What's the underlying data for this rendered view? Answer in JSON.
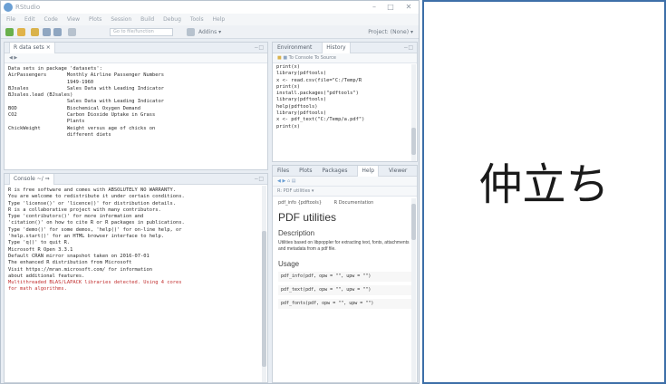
{
  "window": {
    "title": "RStudio",
    "controls": [
      "–",
      "□",
      "✕"
    ]
  },
  "menu": [
    "File",
    "Edit",
    "Code",
    "View",
    "Plots",
    "Session",
    "Build",
    "Debug",
    "Tools",
    "Help"
  ],
  "toolbar": {
    "search_placeholder": "Go to file/function",
    "addins": "Addins ▾",
    "project": "Project: (None) ▾"
  },
  "source_pane": {
    "tab": "R data sets ×",
    "header": "Data sets in package 'datasets':",
    "lines": [
      "",
      "AirPassengers       Monthly Airline Passenger Numbers",
      "                    1949-1960",
      "BJsales             Sales Data with Leading Indicator",
      "BJsales.lead (BJsales)",
      "                    Sales Data with Leading Indicator",
      "BOD                 Biochemical Oxygen Demand",
      "CO2                 Carbon Dioxide Uptake in Grass",
      "                    Plants",
      "ChickWeight         Weight versus age of chicks on",
      "                    different diets"
    ]
  },
  "console_pane": {
    "tab": "Console ~/ ⇒",
    "lines": [
      "R is free software and comes with ABSOLUTELY NO WARRANTY.",
      "You are welcome to redistribute it under certain conditions.",
      "",
      "Type 'license()' or 'licence()' for distribution details.",
      "",
      "R is a collaborative project with many contributors.",
      "Type 'contributors()' for more information and",
      "'citation()' on how to cite R or R packages in publications.",
      "",
      "Type 'demo()' for some demos, 'help()' for on-line help, or",
      "'help.start()' for an HTML browser interface to help.",
      "Type 'q()' to quit R.",
      "",
      "Microsoft R Open 3.3.1",
      "Default CRAN mirror snapshot taken on 2016-07-01",
      "The enhanced R distribution from Microsoft",
      "Visit https://mran.microsoft.com/ for information",
      "about additional features.",
      ""
    ],
    "warning_lines": [
      "Multithreaded BLAS/LAPACK libraries detected. Using 4 cores",
      "for math algorithms."
    ]
  },
  "history_pane": {
    "tabs": [
      "Environment",
      "History"
    ],
    "toolbar": "To Console   To Source",
    "lines": [
      "print(x)",
      "library(pdftools)",
      "x <- read.csv(file=\"C:/Temp/R",
      "print(x)",
      "install.packages(\"pdftools\")",
      "library(pdftools)",
      "help(pdftools)",
      "library(pdftools)",
      "x <- pdf_text(\"C:/Temp/a.pdf\")",
      "print(x)"
    ]
  },
  "help_pane": {
    "tabs": [
      "Files",
      "Plots",
      "Packages",
      "Help",
      "Viewer"
    ],
    "topic_bar": "R: PDF utilities ▾",
    "doc_header_left": "pdf_info {pdftools}",
    "doc_header_right": "R Documentation",
    "title": "PDF utilities",
    "section_description": "Description",
    "description": "Utilities based on libpoppler for extracting text, fonts, attachments and metadata from a pdf file.",
    "section_usage": "Usage",
    "usage": [
      "pdf_info(pdf, opw = \"\", upw = \"\")",
      "pdf_text(pdf, opw = \"\", upw = \"\")",
      "pdf_fonts(pdf, opw = \"\", upw = \"\")"
    ]
  },
  "caption": {
    "text": "仲立ち"
  },
  "colors": {
    "caption_border": "#3d6fa8",
    "warning_text": "#c23030"
  }
}
